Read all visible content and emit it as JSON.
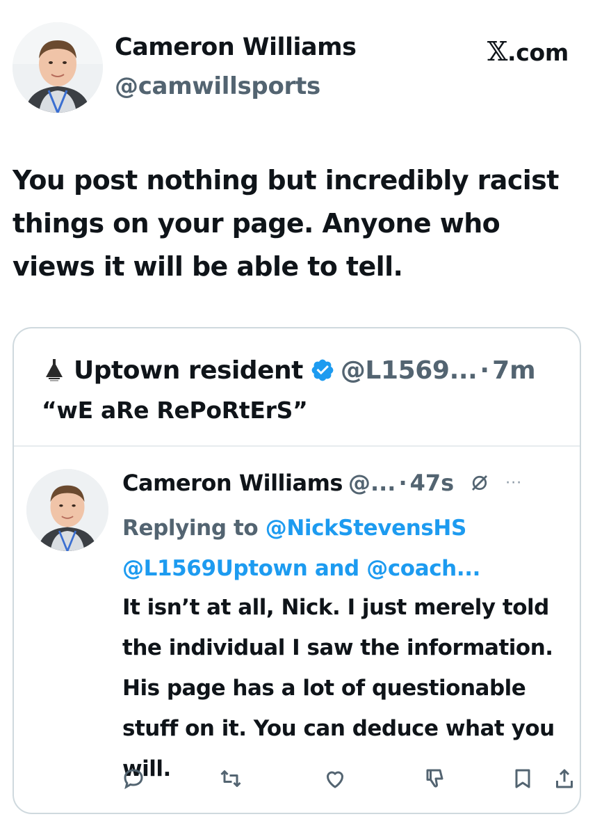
{
  "author": {
    "name": "Cameron Williams",
    "handle": "@camwillsports"
  },
  "brand": {
    "x_glyph": "𝕏",
    "suffix": ".com"
  },
  "tweet": {
    "text": "You post nothing but incredibly racist things on your page. Anyone who views it will be able to tell."
  },
  "quoted": {
    "name": "Uptown resident",
    "handle": "@L1569...",
    "separator": "·",
    "time": "7m",
    "text": "“wE aRe RePoRtErS”",
    "verified": true,
    "reply": {
      "name": "Cameron Williams",
      "handle": "@...",
      "separator": "·",
      "time": "47s",
      "more": "···",
      "replying_prefix": "Replying to",
      "replying_to": "@NickStevensHS",
      "replying_to_2": "@L1569Uptown",
      "replying_and": "and",
      "replying_to_3": "@coach...",
      "text": "It isn’t at all, Nick. I just merely told the individual I saw the information. His page has a lot of questionable stuff on it. You can deduce what you will."
    }
  },
  "actions": [
    "reply-icon",
    "retweet-icon",
    "like-icon",
    "dislike-icon",
    "bookmark-icon",
    "share-icon"
  ],
  "colors": {
    "text": "#0f1419",
    "muted": "#536471",
    "link": "#1d9bf0",
    "verified": "#1d9bf0",
    "border": "#cfd9de"
  }
}
